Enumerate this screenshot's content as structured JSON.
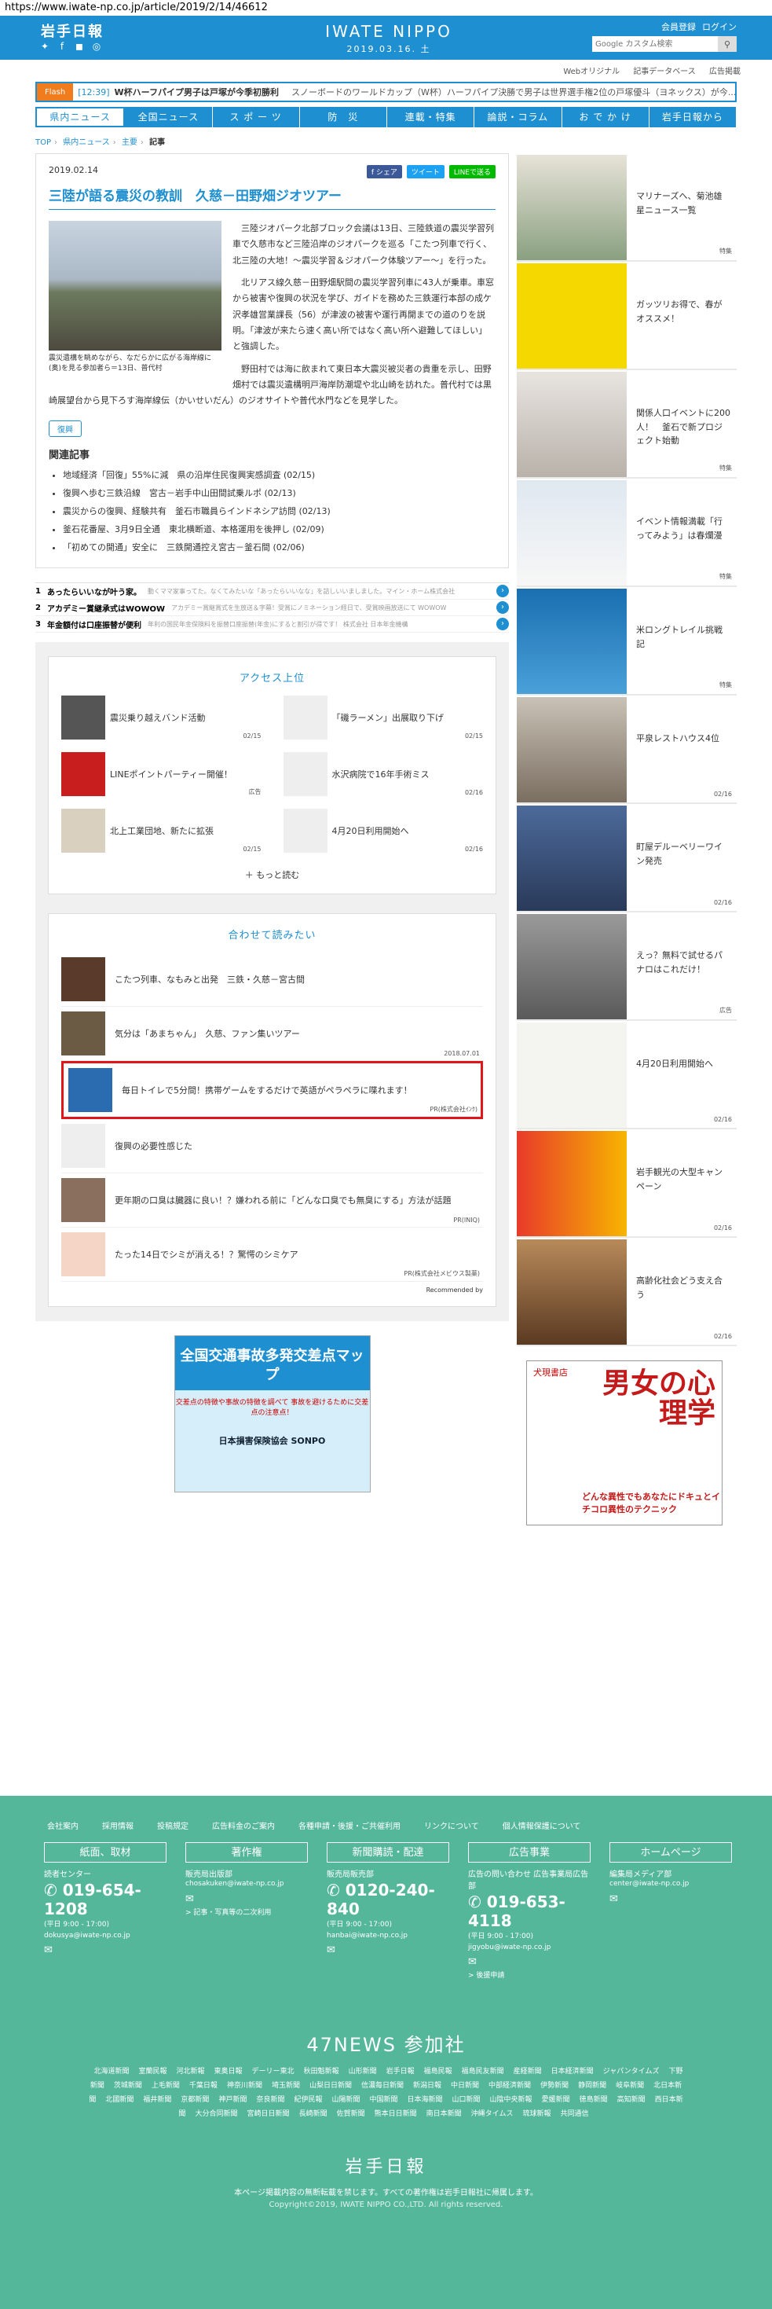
{
  "browser": {
    "url": "https://www.iwate-np.co.jp/article/2019/2/14/46612"
  },
  "header": {
    "logo": "岩手日報",
    "brand": "IWATE NIPPO",
    "date": "2019.03.16. 土",
    "user_links": [
      "会員登録",
      "ログイン"
    ],
    "search_placeholder": "Google カスタム検索",
    "sub_links": [
      "Webオリジナル",
      "記事データベース",
      "広告掲載"
    ]
  },
  "flash": {
    "tag": "Flash",
    "time": "[12:39]",
    "headline": "W杯ハーフパイプ男子は戸塚が今季初勝利",
    "next": "スノーボードのワールドカップ（W杯）ハーフパイプ決勝で男子は世界選手権2位の戸塚優斗（ヨネックス）が今..."
  },
  "nav": [
    "県内ニュース",
    "全国ニュース",
    "ス ポ ー ツ",
    "防　災",
    "連載・特集",
    "論説・コラム",
    "お で か け",
    "岩手日報から"
  ],
  "breadcrumb": [
    "TOP",
    "県内ニュース",
    "主要",
    "記事"
  ],
  "article": {
    "date": "2019.02.14",
    "share": [
      "f シェア",
      "ツイート",
      "LINEで送る"
    ],
    "title": "三陸が語る震災の教訓　久慈－田野畑ジオツアー",
    "caption": "震災遺構を眺めながら、なだらかに広がる海岸線に(奥)を見る参加者ら＝13日、普代村",
    "p1": "三陸ジオパーク北部ブロック会議は13日、三陸鉄道の震災学習列車で久慈市など三陸沿岸のジオパークを巡る「こたつ列車で行く、北三陸の大地！～震災学習＆ジオパーク体験ツアー～」を行った。",
    "p2": "北リアス線久慈－田野畑駅間の震災学習列車に43人が乗車。車窓から被害や復興の状況を学び、ガイドを務めた三鉄運行本部の成ケ沢孝雄営業課長（56）が津波の被害や運行再開までの道のりを説明。「津波が来たら速く高い所ではなく高い所へ避難してほしい」と強調した。",
    "p3": "野田村では海に飲まれて東日本大震災被災者の貴重を示し、田野畑村では震災遺構明戸海岸防潮堤や北山崎を訪れた。普代村では黒崎展望台から見下ろす海岸線伝（かいせいだん）のジオサイトや普代水門などを見学した。",
    "tag": "復興",
    "related_title": "関連記事",
    "related": [
      "地域経済「回復」55%に減　県の沿岸住民復興実感調査 (02/15)",
      "復興へ歩む三鉄沿線　宮古－岩手中山田間試乗ルポ (02/13)",
      "震災からの復興、経験共有　釜石市職員らインドネシア訪問 (02/13)",
      "釜石花番屋、3月9日全通　東北横断道、本格運用を後押し (02/09)",
      "「初めての開通」安全に　三鉄開通控え宮古－釜石間 (02/06)"
    ]
  },
  "ads": [
    {
      "n": "1",
      "title": "あったらいいなが叶う家。",
      "sub": "動くママ家事ってた。なくてみたいな「あったらいいなな」を詰しいいましました。マイン・ホーム株式会社"
    },
    {
      "n": "2",
      "title": "アカデミー賞継承式はWOWOW",
      "sub": "アカデミー賞継賞式を生放送＆字幕！受賞にノミネーション経日で、受賞映画放送にて WOWOW"
    },
    {
      "n": "3",
      "title": "年金額付は口座振替が便利",
      "sub": "年利の国民年金保険料を振替口座振替(年金)にすると割引が得です！ 株式会社 日本年金機構"
    }
  ],
  "access": {
    "title": "アクセス上位",
    "items": [
      {
        "text": "震災乗り越えバンド活動",
        "date": "02/15"
      },
      {
        "text": "「磯ラーメン」出展取り下げ",
        "date": "02/15"
      },
      {
        "text": "LINEポイントパーティー開催！",
        "date": "広告"
      },
      {
        "text": "水沢病院で16年手術ミス",
        "date": "02/16"
      },
      {
        "text": "北上工業団地、新たに拡張",
        "date": "02/15"
      },
      {
        "text": "4月20日利用開始へ",
        "date": "02/16"
      }
    ],
    "more": "もっと読む"
  },
  "recommend": {
    "title": "合わせて読みたい",
    "items": [
      {
        "text": "こたつ列車、なもみと出発　三鉄・久慈－宮古間",
        "date": ""
      },
      {
        "text": "気分は「あまちゃん」　久慈、ファン集いツアー",
        "date": "2018.07.01"
      },
      {
        "text": "毎日トイレで5分間！携帯ゲームをするだけで英語がペラペラに喋れます！",
        "date": "PR(株式会社ｲﾝｸ)"
      },
      {
        "text": "復興の必要性感じた",
        "date": ""
      },
      {
        "text": "更年期の口臭は臓器に良い！？嫌われる前に「どんな口臭でも無臭にする」方法が話題",
        "date": "PR(INIQ)"
      },
      {
        "text": "たった14日でシミが消える！？驚愕のシミケア",
        "date": "PR(株式会社メビウス製薬)"
      }
    ],
    "credit": "Recommended by"
  },
  "banner": {
    "title": "全国交通事故多発交差点マップ",
    "sub": "交差点の特徴や事故の特徴を調べて 事故を避けるために交差点の注意点！",
    "org": "日本損害保険協会 SONPO"
  },
  "sidebar": [
    {
      "text": "マリナーズへ、菊池雄星ニュース一覧",
      "foot": "特集"
    },
    {
      "text": "ガッツリお得で、春がオススメ！",
      "foot": ""
    },
    {
      "text": "関係人口イベントに200人！　釜石で新プロジェクト始動",
      "foot": "特集"
    },
    {
      "text": "イベント情報満載「行ってみよう」は春爛漫",
      "foot": "特集"
    },
    {
      "text": "米ロングトレイル挑戦記",
      "foot": "特集"
    },
    {
      "text": "平泉レストハウス4位",
      "foot": "02/16"
    },
    {
      "text": "町屋デルーベリーワイン発売",
      "foot": "02/16"
    },
    {
      "text": "えっ？無料で試せるパナロはこれだけ！",
      "foot": "広告"
    },
    {
      "text": "4月20日利用開始へ",
      "foot": "02/16"
    },
    {
      "text": "岩手観光の大型キャンペーン",
      "foot": "02/16"
    },
    {
      "text": "高齢化社会どう支え合う",
      "foot": "02/16"
    }
  ],
  "side_ad": {
    "brand": "犬現書店",
    "title": "男女の心理学",
    "tagline": "どんな異性でもあなたにドキュとイチコロ異性のテクニック"
  },
  "footer": {
    "links": [
      "会社案内",
      "採用情報",
      "投稿規定",
      "広告料金のご案内",
      "各種申請・後援・ご共催利用",
      "リンクについて",
      "個人情報保護について"
    ],
    "cols": [
      {
        "head": "紙面、取材",
        "label": "読者センター",
        "phone": "019-654-1208",
        "hours": "(平日 9:00 - 17:00)",
        "mail": "dokusya@iwate-np.co.jp",
        "extra": ""
      },
      {
        "head": "著作権",
        "label": "販売局出版部",
        "phone": "",
        "hours": "",
        "mail": "chosakuken@iwate-np.co.jp",
        "extra": "> 記事・写真等の二次利用"
      },
      {
        "head": "新聞購読・配達",
        "label": "販売局販売部",
        "phone": "0120-240-840",
        "hours": "(平日 9:00 - 17:00)",
        "mail": "hanbai@iwate-np.co.jp",
        "extra": ""
      },
      {
        "head": "広告事業",
        "label": "広告の問い合わせ 広告事業局広告部",
        "phone": "019-653-4118",
        "hours": "(平日 9:00 - 17:00)",
        "mail": "jigyobu@iwate-np.co.jp",
        "extra": "> 後援申請"
      },
      {
        "head": "ホームページ",
        "label": "編集局メディア部",
        "phone": "",
        "hours": "",
        "mail": "center@iwate-np.co.jp",
        "extra": ""
      }
    ],
    "news_title": "47NEWS 参加社",
    "papers": [
      "北海道新聞",
      "室蘭民報",
      "河北新報",
      "東奥日報",
      "デーリー東北",
      "秋田魁新報",
      "山形新聞",
      "岩手日報",
      "福島民報",
      "福島民友新聞",
      "産経新聞",
      "日本経済新聞",
      "ジャパンタイムズ",
      "下野新聞",
      "茨城新聞",
      "上毛新聞",
      "千葉日報",
      "神奈川新聞",
      "埼玉新聞",
      "山梨日日新聞",
      "信濃毎日新聞",
      "新潟日報",
      "中日新聞",
      "中部経済新聞",
      "伊勢新聞",
      "静岡新聞",
      "岐阜新聞",
      "北日本新聞",
      "北國新聞",
      "福井新聞",
      "京都新聞",
      "神戸新聞",
      "奈良新聞",
      "紀伊民報",
      "山陽新聞",
      "中国新聞",
      "日本海新聞",
      "山口新聞",
      "山陰中央新報",
      "愛媛新聞",
      "徳島新聞",
      "高知新聞",
      "西日本新聞",
      "大分合同新聞",
      "宮崎日日新聞",
      "長崎新聞",
      "佐賀新聞",
      "熊本日日新聞",
      "南日本新聞",
      "沖縄タイムス",
      "琉球新報",
      "共同通信"
    ],
    "logo": "岩手日報",
    "note": "本ページ掲載内容の無断転載を禁じます。すべての著作権は岩手日報社に帰属します。",
    "copyright": "Copyright©2019, IWATE NIPPO CO.,LTD. All rights reserved."
  },
  "colors": {
    "brand_blue": "#1e8fd0",
    "footer_green": "#54b79a",
    "flash_orange": "#f07c1e",
    "highlight_red": "#e0161a"
  }
}
